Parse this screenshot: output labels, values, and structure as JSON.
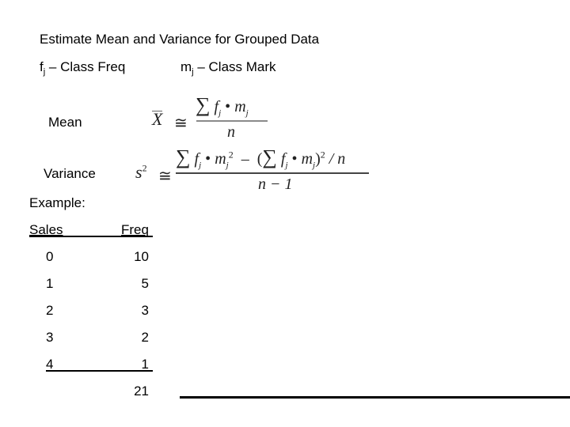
{
  "title": "Estimate Mean and Variance for Grouped Data",
  "definitions": {
    "fj": {
      "symbol": "f",
      "subscript": "j",
      "text": " – Class Freq"
    },
    "mj": {
      "symbol": "m",
      "subscript": "j",
      "text": " – Class Mark"
    }
  },
  "mean": {
    "label": "Mean",
    "lhs": "X",
    "approx": "≅",
    "numerator": "∑ f j • m j",
    "denominator": "n"
  },
  "variance": {
    "label": "Variance",
    "lhs": "s",
    "lhs_exp": "2",
    "approx": "≅",
    "numerator": "∑ f j • m j ² − (∑ f j • m j)² / n",
    "denominator": "n − 1"
  },
  "example": {
    "label": "Example:",
    "headers": [
      "Sales",
      "Freq"
    ],
    "rows": [
      {
        "sales": "0",
        "freq": "10"
      },
      {
        "sales": "1",
        "freq": "5"
      },
      {
        "sales": "2",
        "freq": "3"
      },
      {
        "sales": "3",
        "freq": "2"
      },
      {
        "sales": "4",
        "freq": "1"
      }
    ],
    "total": "21"
  }
}
